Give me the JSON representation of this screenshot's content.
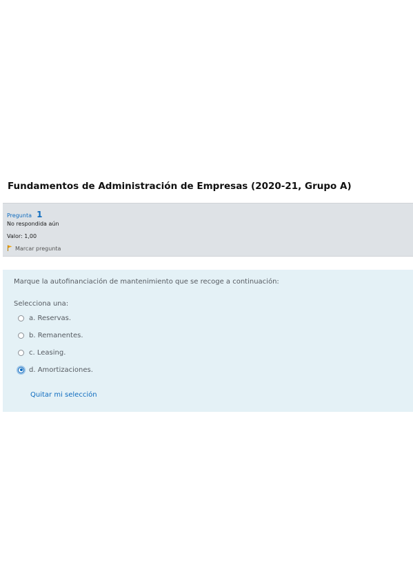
{
  "course": {
    "title": "Fundamentos de Administración de Empresas (2020-21, Grupo A)"
  },
  "question_info": {
    "label": "Pregunta",
    "number": "1",
    "state": "No respondida aún",
    "grade": "Valor: 1,00",
    "flag_label": "Marcar pregunta",
    "flag_icon": "flag-icon"
  },
  "question": {
    "text": "Marque la autofinanciación de mantenimiento que se recoge a continuación:",
    "prompt": "Selecciona una:",
    "options": [
      {
        "label": "a. Reservas.",
        "selected": false
      },
      {
        "label": "b. Remanentes.",
        "selected": false
      },
      {
        "label": "c. Leasing.",
        "selected": false
      },
      {
        "label": "d. Amortizaciones.",
        "selected": true
      }
    ],
    "clear_label": "Quitar mi selección"
  },
  "colors": {
    "info_panel_bg": "#dee2e6",
    "content_panel_bg": "#e4f1f6",
    "accent": "#0f6cbf",
    "flag": "#f0a000"
  }
}
